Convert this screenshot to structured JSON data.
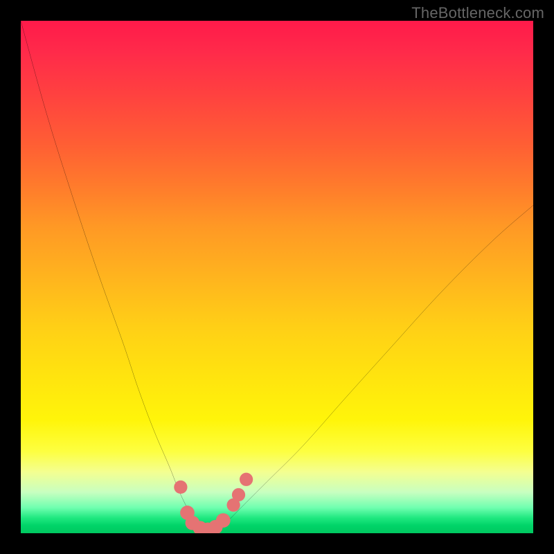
{
  "watermark": "TheBottleneck.com",
  "chart_data": {
    "type": "line",
    "title": "",
    "xlabel": "",
    "ylabel": "",
    "xlim": [
      0,
      100
    ],
    "ylim": [
      0,
      100
    ],
    "series": [
      {
        "name": "bottleneck-curve",
        "color": "#000000",
        "x": [
          0,
          5,
          10,
          15,
          20,
          23,
          26,
          29,
          31,
          33,
          34.5,
          36,
          38,
          40,
          43,
          48,
          55,
          63,
          72,
          82,
          92,
          100
        ],
        "y": [
          100,
          82,
          66,
          51,
          37,
          28,
          20,
          13,
          8,
          4,
          2,
          0.5,
          0.5,
          2,
          5,
          10,
          17,
          26,
          36,
          47,
          57,
          64
        ]
      }
    ],
    "markers": [
      {
        "x": 31.2,
        "y": 9.0,
        "r": 1.3,
        "name": "point-left-upper"
      },
      {
        "x": 32.5,
        "y": 4.0,
        "r": 1.4,
        "name": "point-left-mid"
      },
      {
        "x": 33.5,
        "y": 2.0,
        "r": 1.4,
        "name": "point-trough-l1"
      },
      {
        "x": 35.0,
        "y": 1.0,
        "r": 1.4,
        "name": "point-trough-l2"
      },
      {
        "x": 36.5,
        "y": 0.7,
        "r": 1.4,
        "name": "point-trough-center"
      },
      {
        "x": 38.0,
        "y": 1.2,
        "r": 1.4,
        "name": "point-trough-r1"
      },
      {
        "x": 39.5,
        "y": 2.5,
        "r": 1.4,
        "name": "point-trough-r2"
      },
      {
        "x": 41.5,
        "y": 5.5,
        "r": 1.3,
        "name": "point-right-mid1"
      },
      {
        "x": 42.5,
        "y": 7.5,
        "r": 1.3,
        "name": "point-right-mid2"
      },
      {
        "x": 44.0,
        "y": 10.5,
        "r": 1.3,
        "name": "point-right-upper"
      }
    ],
    "marker_color": "#e57373",
    "gradient_stops": [
      {
        "pos": 0,
        "color": "#ff1a4a"
      },
      {
        "pos": 50,
        "color": "#ffb41e"
      },
      {
        "pos": 80,
        "color": "#fff50a"
      },
      {
        "pos": 95,
        "color": "#70ffb0"
      },
      {
        "pos": 100,
        "color": "#00c860"
      }
    ]
  }
}
